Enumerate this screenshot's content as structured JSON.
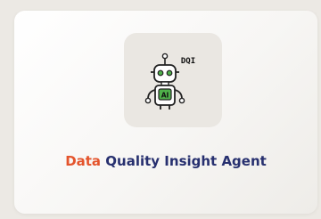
{
  "card": {
    "icon_name": "robot-ai-icon",
    "icon_badge": "DQI",
    "icon_chest": "AI",
    "title_accent": "Data",
    "title_rest": "Quality Insight Agent"
  },
  "colors": {
    "accent": "#e4542c",
    "title": "#27306f",
    "robot_green": "#4fb04a"
  }
}
